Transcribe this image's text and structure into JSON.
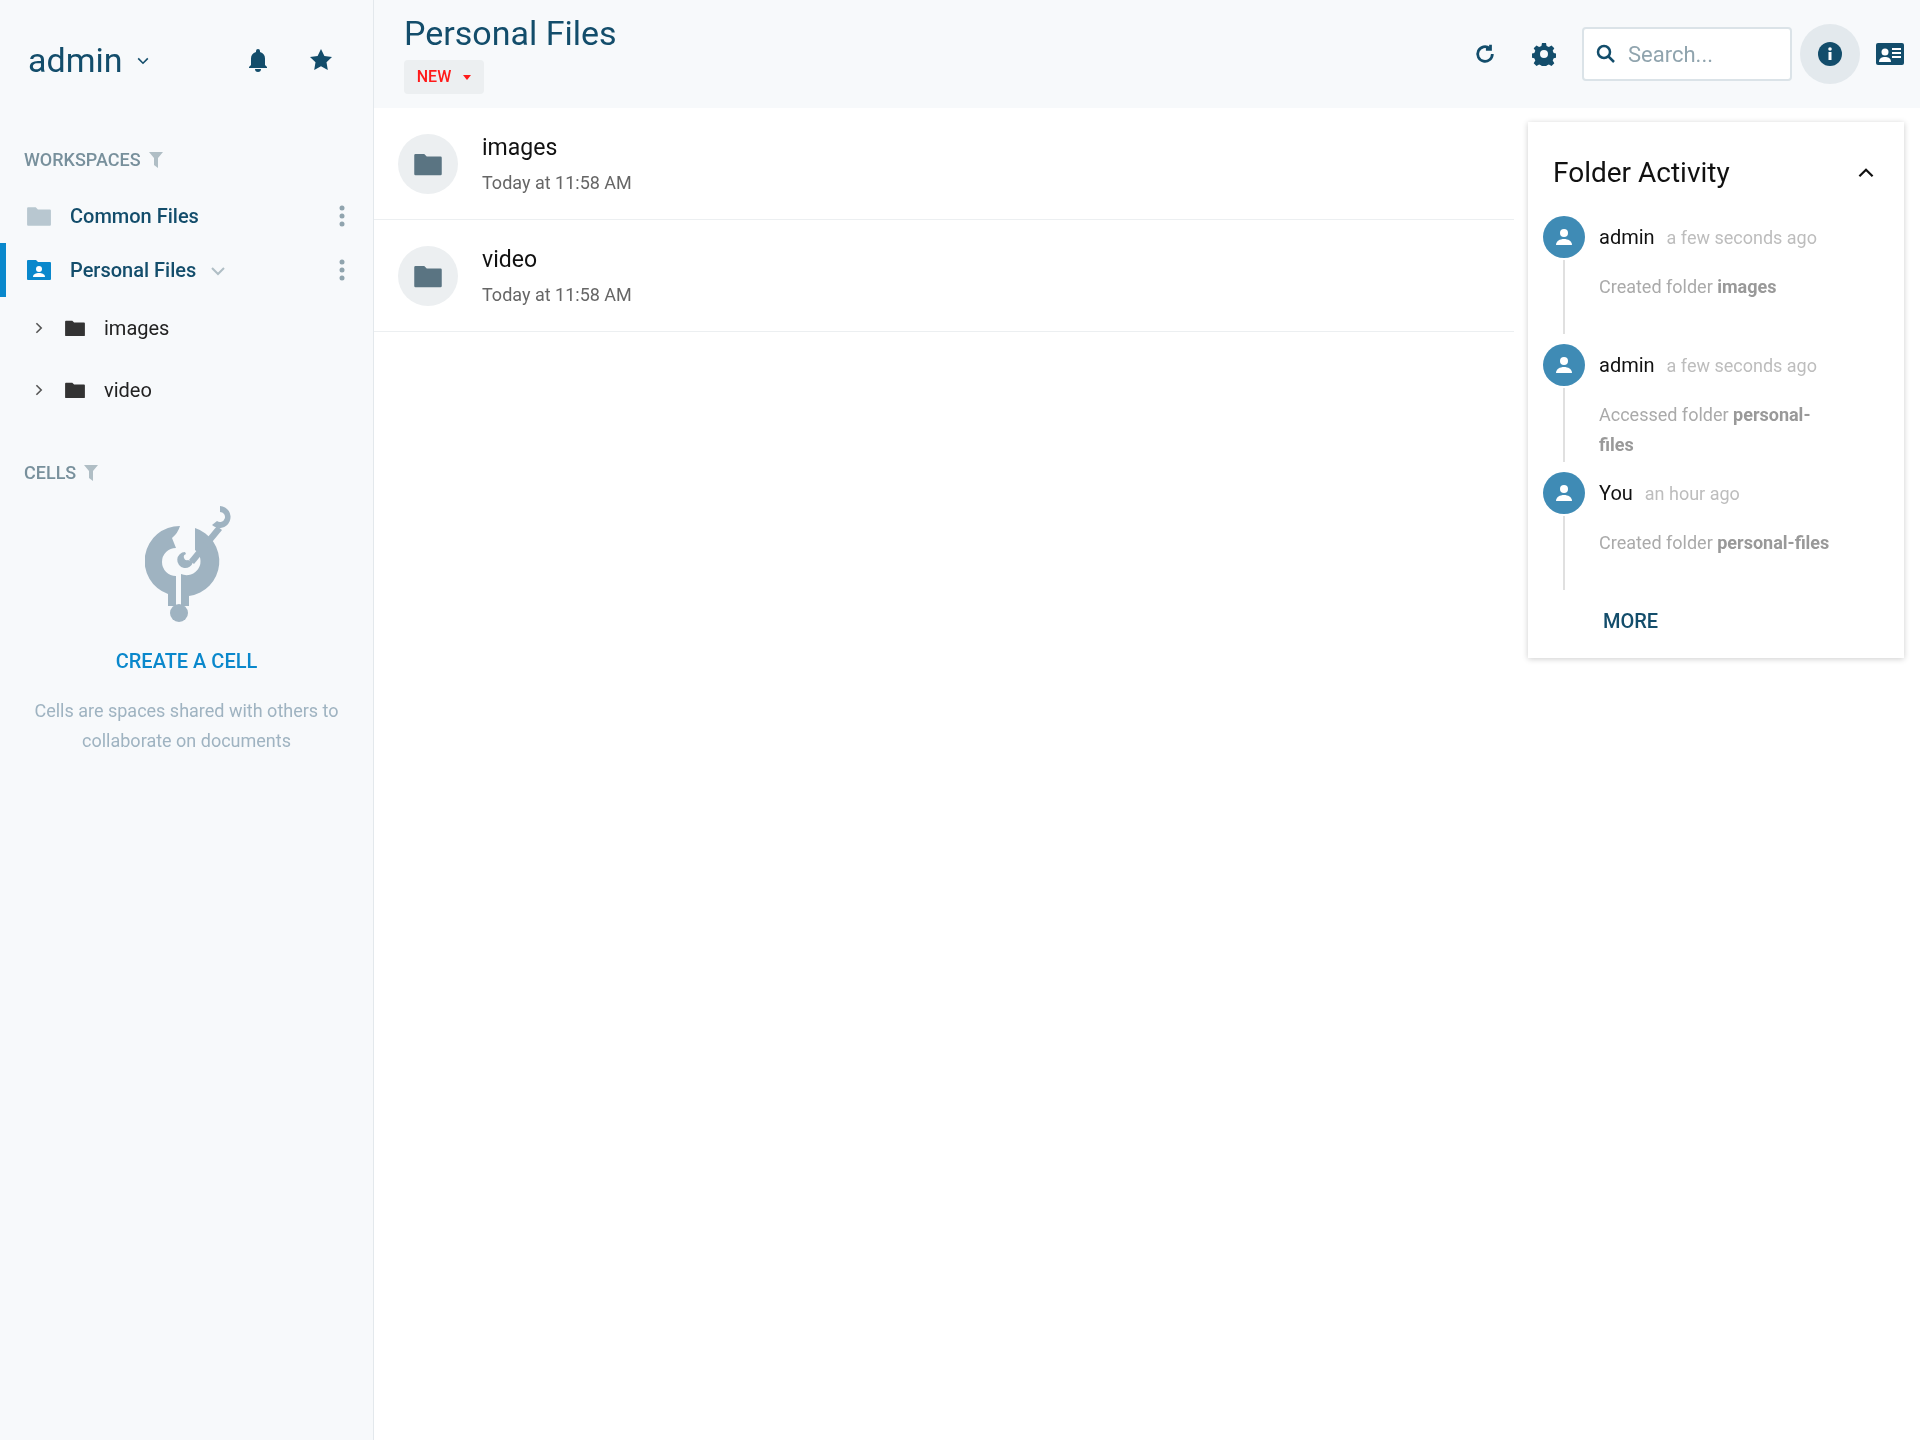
{
  "sidebar": {
    "user": "admin",
    "workspaces_heading": "WORKSPACES",
    "workspaces": [
      {
        "label": "Common Files",
        "kind": "common",
        "selected": false,
        "expanded": false
      },
      {
        "label": "Personal Files",
        "kind": "personal",
        "selected": true,
        "expanded": true,
        "children": [
          {
            "label": "images",
            "expanded": false
          },
          {
            "label": "video",
            "expanded": false
          }
        ]
      }
    ],
    "cells_heading": "CELLS",
    "create_cell": "CREATE A CELL",
    "cells_hint": "Cells are spaces shared with others to collaborate on documents"
  },
  "header": {
    "title": "Personal Files",
    "new_button": "NEW",
    "search": {
      "placeholder": "Search..."
    },
    "info_button": {
      "selected": true
    }
  },
  "files": [
    {
      "name": "images",
      "modified": "Today at 11:58 AM"
    },
    {
      "name": "video",
      "modified": "Today at 11:58 AM"
    }
  ],
  "activity": {
    "title": "Folder Activity",
    "expanded": true,
    "more": "MORE",
    "items": [
      {
        "user": "admin",
        "time": "a few seconds ago",
        "text": "Created folder **images**"
      },
      {
        "user": "admin",
        "time": "a few seconds ago",
        "text": "Accessed folder **personal-files**"
      },
      {
        "user": "You",
        "time": "an hour ago",
        "text": "Created folder **personal-files**"
      }
    ]
  }
}
